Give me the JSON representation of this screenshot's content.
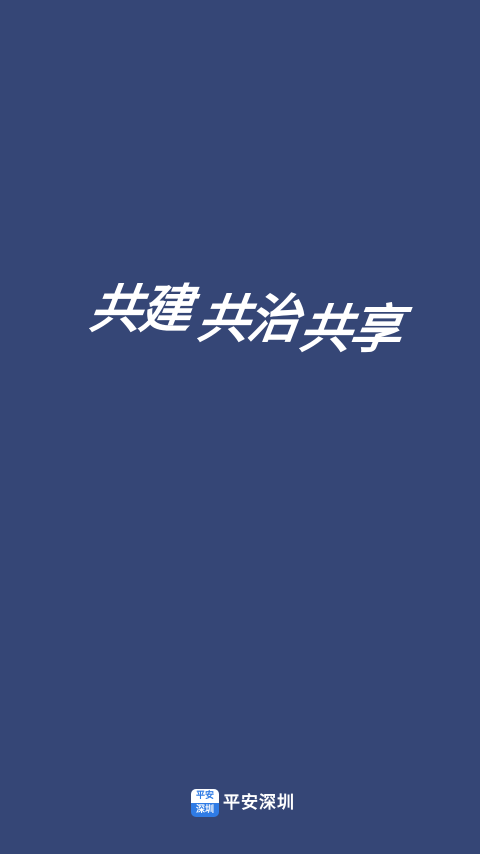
{
  "splash": {
    "slogan_part1": "共建",
    "slogan_part2": "共治",
    "slogan_part3": "共享",
    "background_color": "#354676"
  },
  "brand": {
    "logo_top": "平安",
    "logo_bottom": "深圳",
    "name": "平安深圳",
    "logo_color": "#2f7be5"
  }
}
